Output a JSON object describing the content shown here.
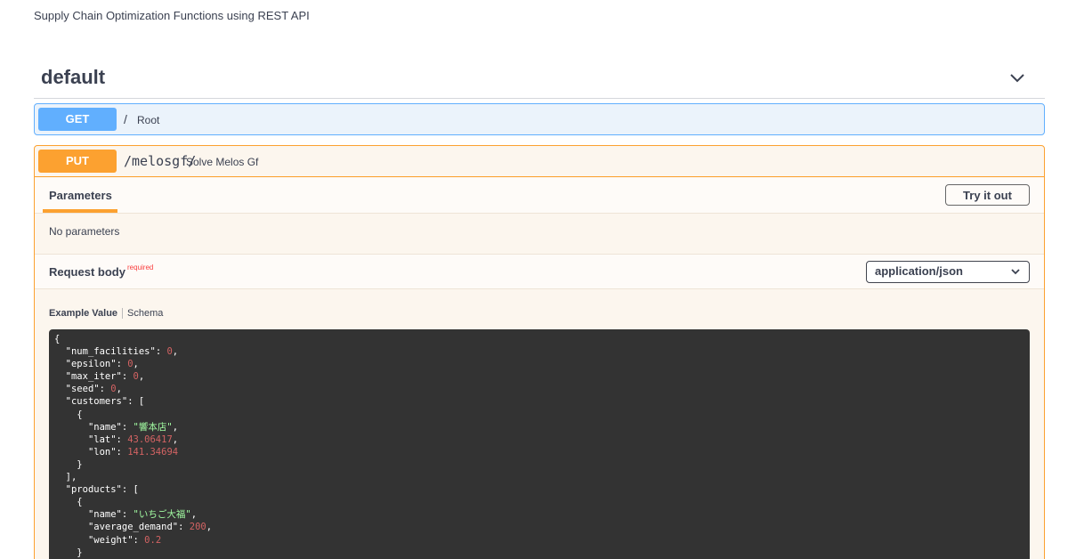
{
  "description": "Supply Chain Optimization Functions using REST API",
  "section": {
    "title": "default"
  },
  "operations": [
    {
      "method": "GET",
      "path": "/",
      "summary": "Root"
    },
    {
      "method": "PUT",
      "path": "/melosgf/",
      "summary": "Solve Melos Gf"
    }
  ],
  "put_details": {
    "parameters_tab": "Parameters",
    "try_it_out": "Try it out",
    "no_parameters": "No parameters",
    "request_body_label": "Request body",
    "required_label": "required",
    "content_type": "application/json",
    "example_value_tab": "Example Value",
    "schema_tab": "Schema"
  },
  "example_json_lines": [
    [
      [
        "p",
        "{"
      ]
    ],
    [
      [
        "p",
        "  "
      ],
      [
        "k",
        "\"num_facilities\""
      ],
      [
        "p",
        ": "
      ],
      [
        "n",
        "0"
      ],
      [
        "p",
        ","
      ]
    ],
    [
      [
        "p",
        "  "
      ],
      [
        "k",
        "\"epsilon\""
      ],
      [
        "p",
        ": "
      ],
      [
        "n",
        "0"
      ],
      [
        "p",
        ","
      ]
    ],
    [
      [
        "p",
        "  "
      ],
      [
        "k",
        "\"max_iter\""
      ],
      [
        "p",
        ": "
      ],
      [
        "n",
        "0"
      ],
      [
        "p",
        ","
      ]
    ],
    [
      [
        "p",
        "  "
      ],
      [
        "k",
        "\"seed\""
      ],
      [
        "p",
        ": "
      ],
      [
        "n",
        "0"
      ],
      [
        "p",
        ","
      ]
    ],
    [
      [
        "p",
        "  "
      ],
      [
        "k",
        "\"customers\""
      ],
      [
        "p",
        ": ["
      ]
    ],
    [
      [
        "p",
        "    {"
      ]
    ],
    [
      [
        "p",
        "      "
      ],
      [
        "k",
        "\"name\""
      ],
      [
        "p",
        ": "
      ],
      [
        "s",
        "\"響本店\""
      ],
      [
        "p",
        ","
      ]
    ],
    [
      [
        "p",
        "      "
      ],
      [
        "k",
        "\"lat\""
      ],
      [
        "p",
        ": "
      ],
      [
        "n",
        "43.06417"
      ],
      [
        "p",
        ","
      ]
    ],
    [
      [
        "p",
        "      "
      ],
      [
        "k",
        "\"lon\""
      ],
      [
        "p",
        ": "
      ],
      [
        "n",
        "141.34694"
      ]
    ],
    [
      [
        "p",
        "    }"
      ]
    ],
    [
      [
        "p",
        "  ],"
      ]
    ],
    [
      [
        "p",
        "  "
      ],
      [
        "k",
        "\"products\""
      ],
      [
        "p",
        ": ["
      ]
    ],
    [
      [
        "p",
        "    {"
      ]
    ],
    [
      [
        "p",
        "      "
      ],
      [
        "k",
        "\"name\""
      ],
      [
        "p",
        ": "
      ],
      [
        "s",
        "\"いちご大福\""
      ],
      [
        "p",
        ","
      ]
    ],
    [
      [
        "p",
        "      "
      ],
      [
        "k",
        "\"average_demand\""
      ],
      [
        "p",
        ": "
      ],
      [
        "n",
        "200"
      ],
      [
        "p",
        ","
      ]
    ],
    [
      [
        "p",
        "      "
      ],
      [
        "k",
        "\"weight\""
      ],
      [
        "p",
        ": "
      ],
      [
        "n",
        "0.2"
      ]
    ],
    [
      [
        "p",
        "    }"
      ]
    ]
  ],
  "colors": {
    "get": "#61affe",
    "put": "#fca130",
    "code_bg": "#333333",
    "number": "#d36363",
    "string": "#a2fca2"
  },
  "icons": {
    "collapse": "chevron-down-icon",
    "select": "chevron-down-icon"
  }
}
